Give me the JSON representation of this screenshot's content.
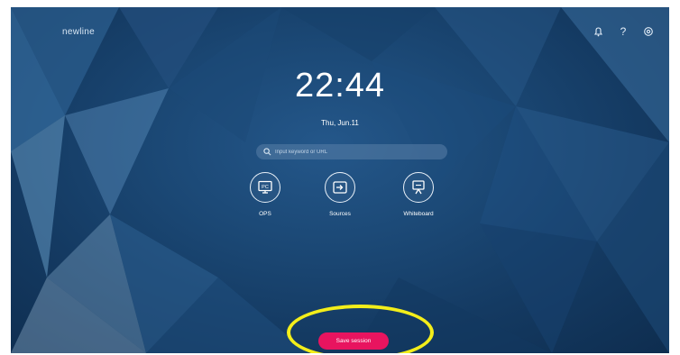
{
  "brand": {
    "name": "newline"
  },
  "top_icons": [
    {
      "name": "notification-bell-icon",
      "glyph": "∇"
    },
    {
      "name": "help-icon",
      "glyph": "?"
    },
    {
      "name": "settings-icon",
      "glyph": "⚙"
    }
  ],
  "clock": {
    "time": "22:44",
    "date": "Thu, Jun.11"
  },
  "search": {
    "placeholder": "Input keyword or URL"
  },
  "apps": [
    {
      "label": "OPS",
      "icon": "ops-pc-icon"
    },
    {
      "label": "Sources",
      "icon": "sources-input-icon"
    },
    {
      "label": "Whiteboard",
      "icon": "whiteboard-icon"
    }
  ],
  "save_session": {
    "label": "Save session"
  },
  "colors": {
    "accent": "#e8145f",
    "highlight": "#f3ee1a",
    "background": "#1b4875"
  }
}
